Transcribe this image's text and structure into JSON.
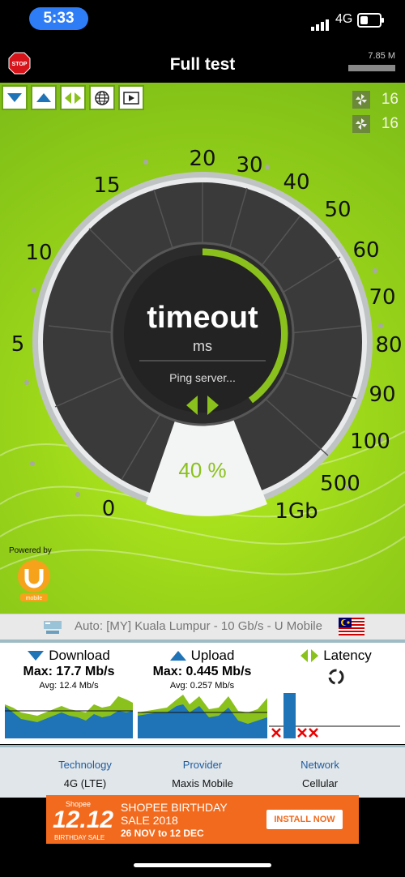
{
  "status_bar": {
    "time": "5:33",
    "network": "4G"
  },
  "header": {
    "title": "Full test",
    "data_used": "7.85 M",
    "stop_label": "STOP"
  },
  "servers": {
    "count_a": "16",
    "count_b": "16"
  },
  "gauge": {
    "ticks": [
      "0",
      "5",
      "10",
      "15",
      "20",
      "30",
      "40",
      "50",
      "60",
      "70",
      "80",
      "90",
      "100",
      "500",
      "1Gb"
    ],
    "value": "timeout",
    "unit": "ms",
    "status": "Ping server...",
    "percent": "40 %",
    "progress": 0.4
  },
  "powered_by": {
    "label": "Powered by",
    "logo_text": "mobile"
  },
  "server_line": "Auto: [MY] Kuala Lumpur - 10 Gb/s - U Mobile",
  "results": {
    "download": {
      "label": "Download",
      "max": "Max: 17.7 Mb/s",
      "avg": "Avg: 12.4 Mb/s"
    },
    "upload": {
      "label": "Upload",
      "max": "Max: 0.445 Mb/s",
      "avg": "Avg: 0.257 Mb/s"
    },
    "latency": {
      "label": "Latency"
    }
  },
  "info": {
    "technology_label": "Technology",
    "technology_value": "4G (LTE)",
    "provider_label": "Provider",
    "provider_value": "Maxis Mobile",
    "network_label": "Network",
    "network_value": "Cellular"
  },
  "ad": {
    "brand": "Shopee",
    "big": "12.12",
    "sub": "BIRTHDAY SALE",
    "line1": "SHOPEE BIRTHDAY",
    "line2": "SALE 2018",
    "line3": "26 NOV to 12 DEC",
    "cta": "INSTALL NOW"
  },
  "colors": {
    "accent": "#8ac11c",
    "download": "#1f73b7",
    "upload_fill": "#8ac11c"
  }
}
